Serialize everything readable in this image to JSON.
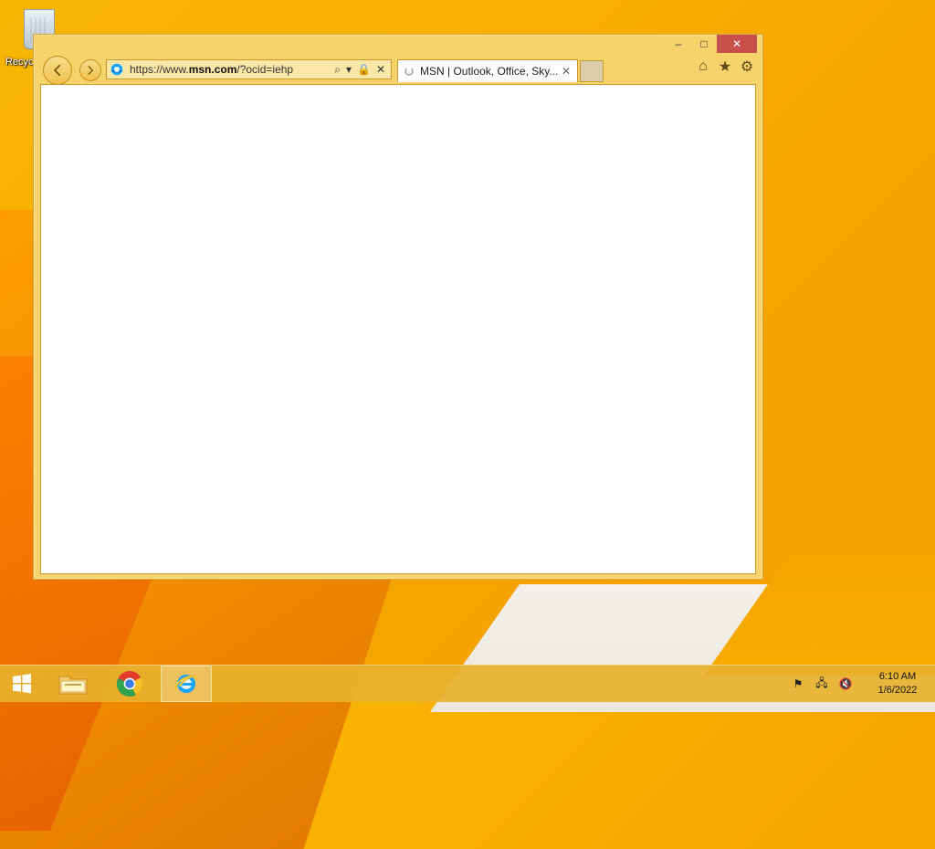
{
  "desktop": {
    "recycle_bin_label": "Recyc"
  },
  "browser": {
    "window_controls": {
      "minimize": "–",
      "maximize": "□",
      "close": "✕"
    },
    "address": {
      "url_prefix": "https://www.",
      "url_host": "msn.com",
      "url_suffix": "/?ocid=iehp"
    },
    "tab": {
      "title": "MSN | Outlook, Office, Sky..."
    }
  },
  "taskbar": {
    "clock": {
      "time": "6:10 AM",
      "date": "1/6/2022"
    }
  },
  "colors": {
    "desktop_accent": "#f7b500",
    "window_frame": "#f6d36b",
    "close_button": "#c7504a",
    "taskbar": "#e7b12c"
  }
}
